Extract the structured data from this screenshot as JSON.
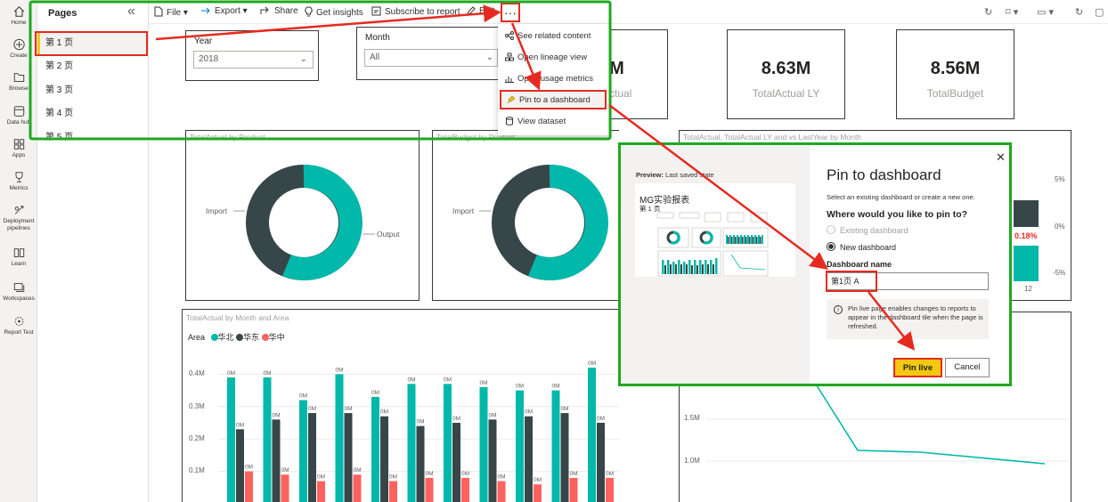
{
  "rail": [
    {
      "label": "Home",
      "icon": "home-icon"
    },
    {
      "label": "Create",
      "icon": "create-icon"
    },
    {
      "label": "Browse",
      "icon": "browse-icon"
    },
    {
      "label": "Data hub",
      "icon": "data-hub-icon"
    },
    {
      "label": "Apps",
      "icon": "apps-icon"
    },
    {
      "label": "Metrics",
      "icon": "metrics-icon"
    },
    {
      "label": "Deployment pipelines",
      "icon": "pipelines-icon"
    },
    {
      "label": "Learn",
      "icon": "learn-icon"
    },
    {
      "label": "Workspaces",
      "icon": "workspaces-icon"
    },
    {
      "label": "Report Test",
      "icon": "report-test-icon"
    }
  ],
  "pages": {
    "title": "Pages",
    "items": [
      "第 1 页",
      "第 2 页",
      "第 3 页",
      "第 4 页",
      "第 5 页"
    ],
    "active_index": 0
  },
  "toolbar": {
    "file": "File",
    "export": "Export",
    "share": "Share",
    "insights": "Get insights",
    "subscribe": "Subscribe to report",
    "edit": "Edit",
    "more": "···"
  },
  "menu": {
    "items": [
      "See related content",
      "Open lineage view",
      "Open usage metrics",
      "Pin to a dashboard",
      "View dataset"
    ]
  },
  "slicers": {
    "year": {
      "title": "Year",
      "value": "2018"
    },
    "month": {
      "title": "Month",
      "value": "All"
    }
  },
  "kpis": [
    {
      "value": "6M",
      "label": "ctual"
    },
    {
      "value": "8.63M",
      "label": "TotalActual LY"
    },
    {
      "value": "8.56M",
      "label": "TotalBudget"
    }
  ],
  "visuals": {
    "donut1": {
      "title": "TotalActual by Product",
      "labels": [
        "Import",
        "Output"
      ]
    },
    "donut2": {
      "title": "TotalBudget by Product",
      "labels": [
        "Import"
      ]
    },
    "combo": {
      "title": "TotalActual, TotalActual LY and vs LastYear by Month",
      "axis_right": [
        "5%",
        "0%",
        "-5%"
      ],
      "x_label": "12",
      "value_label": "0.18%"
    },
    "line": {
      "ticks": [
        "1.5M",
        "1.0M"
      ]
    },
    "bars": {
      "title": "TotalActual by Month and Area",
      "legend_title": "Area",
      "legend": [
        "华北",
        "华东",
        "华中"
      ],
      "y_ticks": [
        "0.4M",
        "0.3M",
        "0.2M",
        "0.1M"
      ],
      "bar_label": "0M"
    }
  },
  "colors": {
    "teal": "#01b8aa",
    "dark": "#374649",
    "red": "#fd625e",
    "yellow": "#f2c811",
    "green_highlight": "#1fa81f",
    "red_highlight": "#e52b20"
  },
  "chart_data": {
    "type": "bar",
    "title": "TotalActual by Month and Area",
    "categories": [
      "1",
      "2",
      "3",
      "4",
      "5",
      "6",
      "7",
      "8",
      "9",
      "10",
      "11",
      "12"
    ],
    "series": [
      {
        "name": "华北",
        "values": [
          0.39,
          0.39,
          0.32,
          0.4,
          0.33,
          0.37,
          0.37,
          0.36,
          0.35,
          0.35,
          0.42,
          0.36
        ]
      },
      {
        "name": "华东",
        "values": [
          0.23,
          0.26,
          0.28,
          0.28,
          0.27,
          0.24,
          0.25,
          0.26,
          0.27,
          0.28,
          0.25,
          0.29
        ]
      },
      {
        "name": "华中",
        "values": [
          0.1,
          0.09,
          0.07,
          0.09,
          0.07,
          0.08,
          0.08,
          0.07,
          0.06,
          0.08,
          0.08,
          0.08
        ]
      }
    ],
    "ylim": [
      0,
      0.45
    ]
  },
  "dialog": {
    "preview_bold": "Preview:",
    "preview_rest": " Last saved state",
    "thumb_title": "MG实验报表",
    "thumb_sub": "第 1 页",
    "title": "Pin to dashboard",
    "subtitle": "Select an existing dashboard or create a new one.",
    "question": "Where would you like to pin to?",
    "option_existing": "Existing dashboard",
    "option_new": "New dashboard",
    "name_label": "Dashboard name",
    "name_value": "第1页 A",
    "info": "Pin live page enables changes to reports to appear in the dashboard tile when the page is refreshed.",
    "pin_button": "Pin live",
    "cancel_button": "Cancel"
  }
}
